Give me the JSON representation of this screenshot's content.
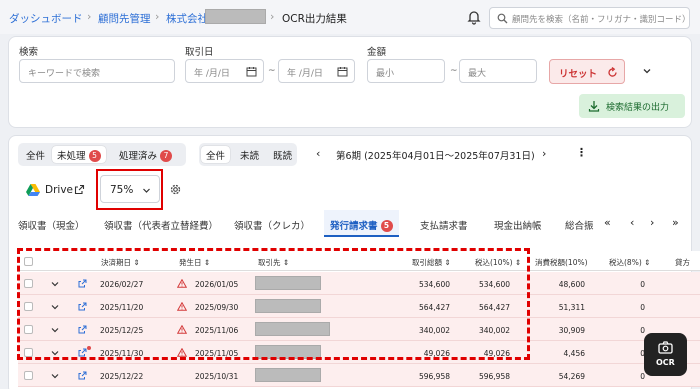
{
  "breadcrumb": {
    "dashboard": "ダッシュボード",
    "clients": "顧問先管理",
    "company": "株式会社",
    "current": "OCR出力結果"
  },
  "header_search": {
    "placeholder": "顧問先を検索（名前・フリガナ・識別コード）"
  },
  "filters": {
    "search_label": "検索",
    "search_placeholder": "キーワードで検索",
    "date_label": "取引日",
    "date_from": "年 /月/日",
    "date_to": "年 /月/日",
    "tilde": "~",
    "amount_label": "金額",
    "amount_min": "最小",
    "amount_max": "最大",
    "reset_label": "リセット",
    "export_label": "検索結果の出力"
  },
  "status_tabs": [
    {
      "label": "全件"
    },
    {
      "label": "未処理",
      "count": "5"
    },
    {
      "label": "処理済み",
      "count": "7"
    }
  ],
  "read_tabs": [
    {
      "label": "全件"
    },
    {
      "label": "未読"
    },
    {
      "label": "既読"
    }
  ],
  "period": {
    "label": "第6期 (2025年04月01日〜2025年07月31日)"
  },
  "drive_label": "Drive",
  "zoom": "75%",
  "doc_tabs": [
    {
      "label": "領収書（現金）"
    },
    {
      "label": "領収書（代表者立替経費）"
    },
    {
      "label": "領収書（クレカ）"
    },
    {
      "label": "発行請求書",
      "count": "5"
    },
    {
      "label": "支払請求書"
    },
    {
      "label": "現金出納帳"
    },
    {
      "label": "総合振"
    }
  ],
  "table": {
    "columns": [
      "決済期日",
      "発生日",
      "取引先",
      "取引総額",
      "税込(10%)",
      "消費税額(10%)",
      "税込(8%)",
      "貸方"
    ],
    "rows": [
      {
        "due": "2026/02/27",
        "date": "2026/01/05",
        "total": "534,600",
        "tax10": "534,600",
        "ctax10": "48,600",
        "tax8": "0",
        "warn": true,
        "dot": false
      },
      {
        "due": "2025/11/20",
        "date": "2025/09/30",
        "total": "564,427",
        "tax10": "564,427",
        "ctax10": "51,311",
        "tax8": "0",
        "warn": true,
        "dot": false
      },
      {
        "due": "2025/12/25",
        "date": "2025/11/06",
        "total": "340,002",
        "tax10": "340,002",
        "ctax10": "30,909",
        "tax8": "0",
        "warn": true,
        "dot": false
      },
      {
        "due": "2025/11/30",
        "date": "2025/11/05",
        "total": "49,026",
        "tax10": "49,026",
        "ctax10": "4,456",
        "tax8": "0",
        "warn": true,
        "dot": true
      },
      {
        "due": "2025/12/22",
        "date": "2025/10/31",
        "total": "596,958",
        "tax10": "596,958",
        "ctax10": "54,269",
        "tax8": "0",
        "warn": false,
        "dot": false
      }
    ]
  },
  "ocr_button": "OCR",
  "colors": {
    "accent": "#2d6fd6",
    "danger": "#e00000",
    "row_bg": "#fdeeee",
    "export_bg": "#d9f1dc"
  }
}
